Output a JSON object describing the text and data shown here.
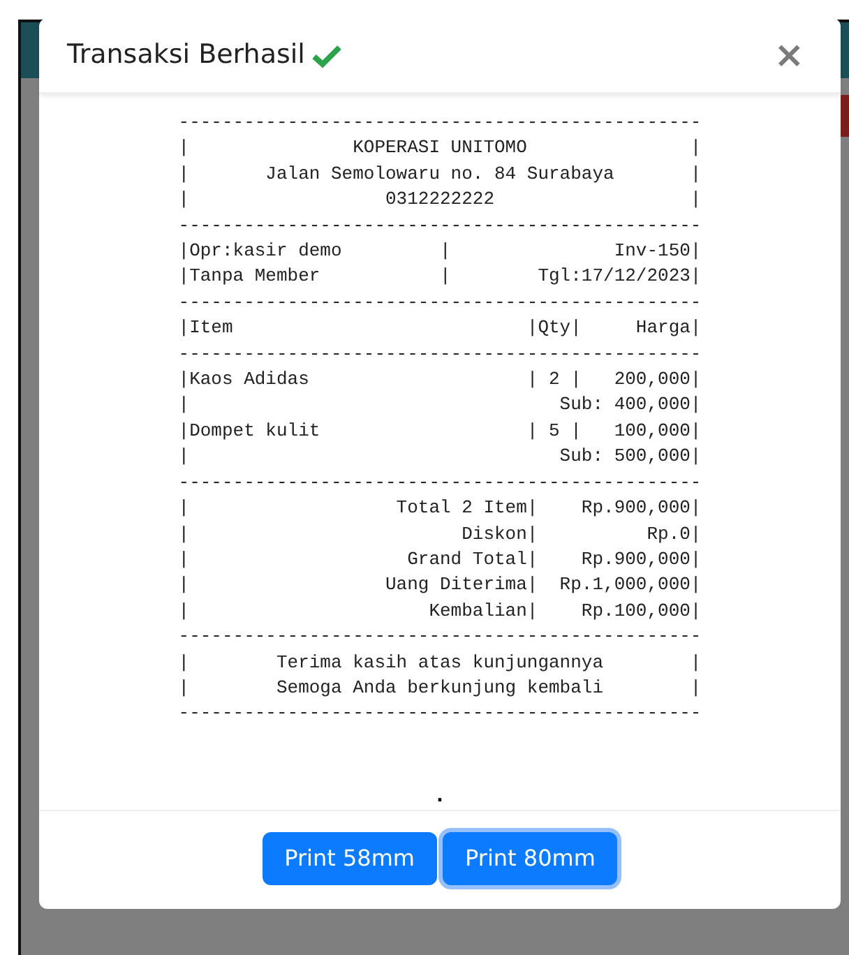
{
  "modal": {
    "title": "Transaksi Berhasil",
    "success": true,
    "close": "×"
  },
  "receipt_lines": [
    "------------------------------------------------",
    "|               KOPERASI UNITOMO               |",
    "|       Jalan Semolowaru no. 84 Surabaya       |",
    "|                  0312222222                  |",
    "------------------------------------------------",
    "|Opr:kasir demo         |               Inv-150|",
    "|Tanpa Member           |        Tgl:17/12/2023|",
    "------------------------------------------------",
    "|Item                           |Qty|     Harga|",
    "------------------------------------------------",
    "|Kaos Adidas                    | 2 |   200,000|",
    "|                                  Sub: 400,000|",
    "|Dompet kulit                   | 5 |   100,000|",
    "|                                  Sub: 500,000|",
    "------------------------------------------------",
    "|                   Total 2 Item|    Rp.900,000|",
    "|                         Diskon|          Rp.0|",
    "|                    Grand Total|    Rp.900,000|",
    "|                  Uang Diterima|  Rp.1,000,000|",
    "|                      Kembalian|    Rp.100,000|",
    "------------------------------------------------",
    "|        Terima kasih atas kunjungannya        |",
    "|        Semoga Anda berkunjung kembali        |",
    "------------------------------------------------"
  ],
  "trailing_mark": ".",
  "buttons": [
    {
      "label": "Print 58mm",
      "focused": false
    },
    {
      "label": "Print 80mm",
      "focused": true
    }
  ]
}
